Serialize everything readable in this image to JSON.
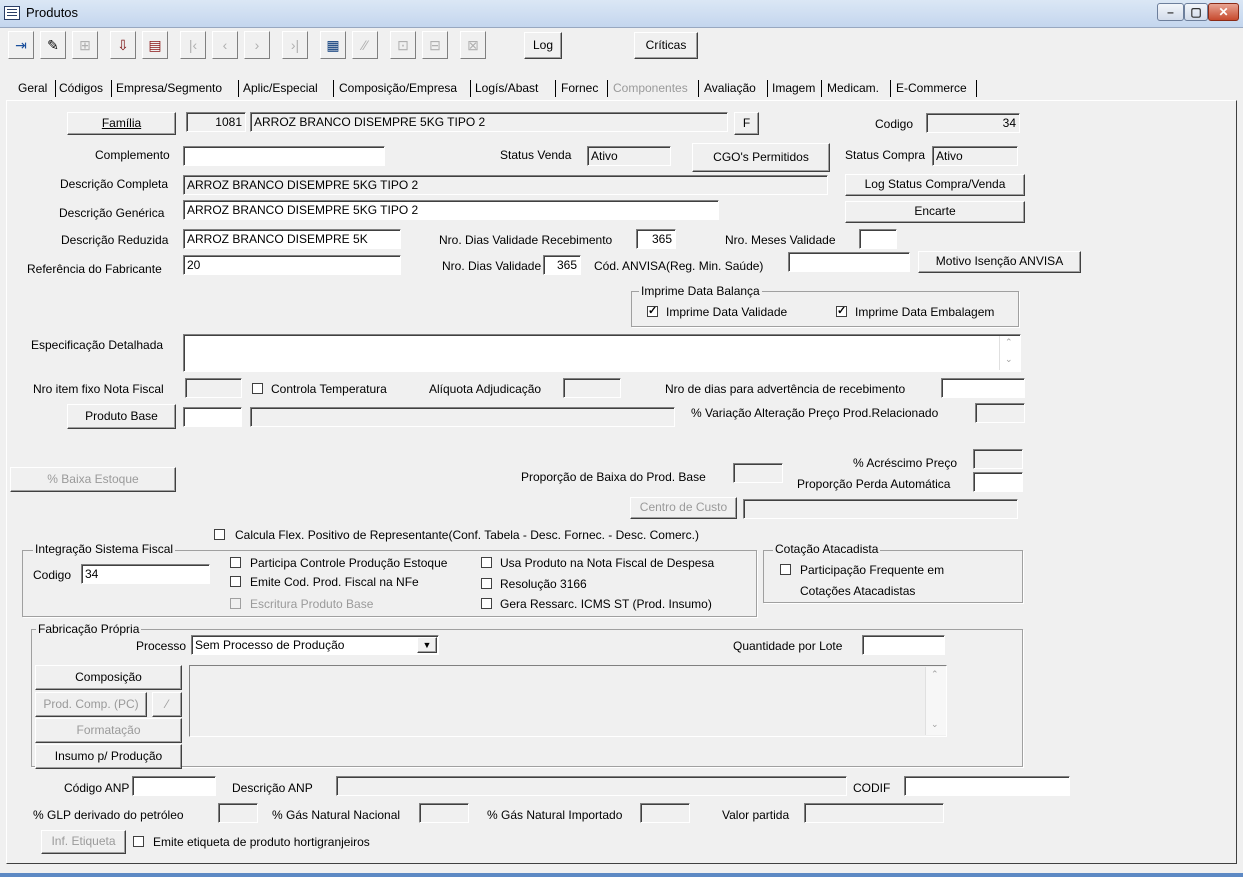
{
  "window": {
    "title": "Produtos",
    "minimize": "–",
    "maximize": "▢",
    "close": "✕"
  },
  "toolbar": {
    "log": "Log",
    "criticas": "Críticas",
    "icons": [
      "exit-icon",
      "edit-icon",
      "tree-icon",
      "save-icon",
      "print-icon",
      "first-icon",
      "prev-icon",
      "next-icon",
      "last-icon",
      "grid-icon",
      "chart-icon",
      "move-icon",
      "export-icon",
      "import-icon"
    ]
  },
  "tabs": [
    "Geral",
    "Códigos",
    "Empresa/Segmento",
    "Aplic/Especial",
    "Composição/Empresa",
    "Logís/Abast",
    "Fornec",
    "Componentes",
    "Avaliação",
    "Imagem",
    "Medicam.",
    "E-Commerce"
  ],
  "geral": {
    "familia_button": "Família",
    "familia_code": "1081",
    "familia_desc": "ARROZ BRANCO DISEMPRE 5KG TIPO 2",
    "f_button": "F",
    "codigo_label": "Codigo",
    "codigo_value": "34",
    "complemento_label": "Complemento",
    "complemento_value": "",
    "status_venda_label": "Status Venda",
    "status_venda_value": "Ativo",
    "cgo_button": "CGO's Permitidos",
    "status_compra_label": "Status Compra",
    "status_compra_value": "Ativo",
    "desc_completa_label": "Descrição Completa",
    "desc_completa_value": "ARROZ BRANCO DISEMPRE 5KG TIPO 2",
    "log_status_button": "Log Status Compra/Venda",
    "desc_generica_label": "Descrição Genérica",
    "desc_generica_value": "ARROZ BRANCO DISEMPRE 5KG TIPO 2",
    "encarte_button": "Encarte",
    "desc_reduzida_label": "Descrição Reduzida",
    "desc_reduzida_value": "ARROZ BRANCO DISEMPRE 5K",
    "dias_val_receb_label": "Nro. Dias Validade Recebimento",
    "dias_val_receb_value": "365",
    "meses_validade_label": "Nro. Meses Validade",
    "meses_validade_value": "",
    "ref_fabricante_label": "Referência do Fabricante",
    "ref_fabricante_value": "20",
    "dias_validade_label": "Nro. Dias Validade",
    "dias_validade_value": "365",
    "anvisa_label": "Cód. ANVISA(Reg. Min. Saúde)",
    "anvisa_value": "",
    "motivo_anvisa_button": "Motivo Isenção ANVISA",
    "imprime_group_title": "Imprime Data Balança",
    "imprime_validade_label": "Imprime Data Validade",
    "imprime_embalagem_label": "Imprime Data Embalagem",
    "espec_label": "Especificação Detalhada",
    "espec_value": "",
    "nro_item_fixo_label": "Nro item fixo Nota Fiscal",
    "controla_temp_label": "Controla Temperatura",
    "aliquota_label": "Alíquota Adjudicação",
    "nro_dias_advert_label": "Nro de dias para advertência de recebimento",
    "produto_base_button": "Produto Base",
    "variacao_label": "% Variação Alteração Preço Prod.Relacionado",
    "baixa_estoque_button": "% Baixa Estoque",
    "acrescimo_label": "% Acréscimo Preço",
    "proporcao_baixa_label": "Proporção de Baixa do Prod. Base",
    "proporcao_perda_label": "Proporção Perda Automática",
    "centro_custo_button": "Centro de Custo",
    "calcula_flex_label": "Calcula Flex. Positivo de Representante(Conf. Tabela - Desc. Fornec. - Desc. Comerc.)"
  },
  "fiscal": {
    "title": "Integração Sistema Fiscal",
    "codigo_label": "Codigo",
    "codigo_value": "34",
    "participa_label": "Participa Controle Produção Estoque",
    "emite_cod_label": "Emite Cod. Prod. Fiscal na NFe",
    "escritura_label": "Escritura Produto Base",
    "usa_produto_label": "Usa Produto na Nota Fiscal de Despesa",
    "resolucao_label": "Resolução 3166",
    "gera_ressarc_label": "Gera Ressarc. ICMS ST (Prod. Insumo)"
  },
  "cotacao": {
    "title": "Cotação Atacadista",
    "line1": "Participação Frequente em",
    "line2": "Cotações Atacadistas"
  },
  "fabricacao": {
    "title": "Fabricação Própria",
    "processo_label": "Processo",
    "processo_value": "Sem Processo de Produção",
    "qtd_lote_label": "Quantidade por Lote",
    "composicao_button": "Composição",
    "prod_comp_button": "Prod. Comp. (PC)",
    "formatacao_button": "Formatação",
    "insumo_button": "Insumo p/ Produção"
  },
  "anp": {
    "codigo_label": "Código ANP",
    "descricao_label": "Descrição ANP",
    "codif_label": "CODIF",
    "glp_label": "% GLP derivado do petróleo",
    "gas_nacional_label": "% Gás Natural Nacional",
    "gas_importado_label": "% Gás Natural Importado",
    "valor_partida_label": "Valor partida",
    "inf_etiqueta_button": "Inf. Etiqueta",
    "emite_etiqueta_label": "Emite etiqueta de produto hortigranjeiros"
  }
}
